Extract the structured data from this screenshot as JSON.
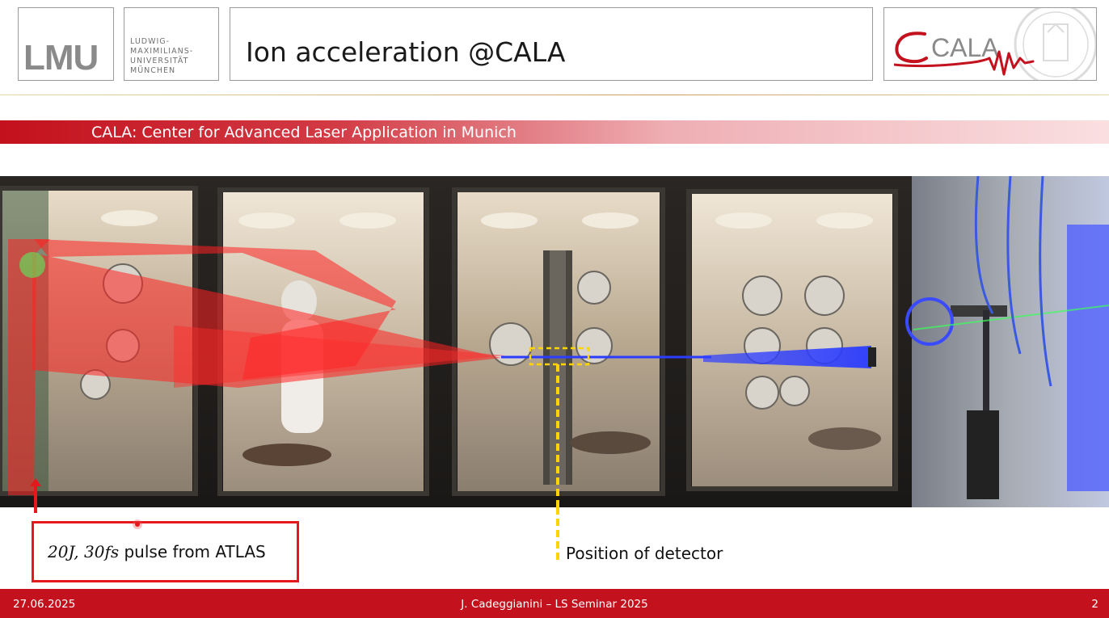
{
  "header": {
    "lmu_logo": "LMU",
    "university_lines": [
      "LUDWIG-",
      "MAXIMILIANS-",
      "UNIVERSITÄT",
      "MÜNCHEN"
    ],
    "title": "Ion acceleration @CALA",
    "cala_logo": "CALA"
  },
  "subheader": "CALA: Center for Advanced Laser Application in Munich",
  "annotations": {
    "pulse_math": "20J, 30fs",
    "pulse_rest": " pulse from ATLAS",
    "detector_label": "Position of detector"
  },
  "footer": {
    "date": "27.06.2025",
    "center": "J. Cadeggianini – LS Seminar 2025",
    "page": "2"
  },
  "colors": {
    "brand_red": "#c3111d",
    "highlight_red": "#e5181e",
    "detector_yellow": "#ffd400",
    "beam_blue": "#2b3cff"
  }
}
